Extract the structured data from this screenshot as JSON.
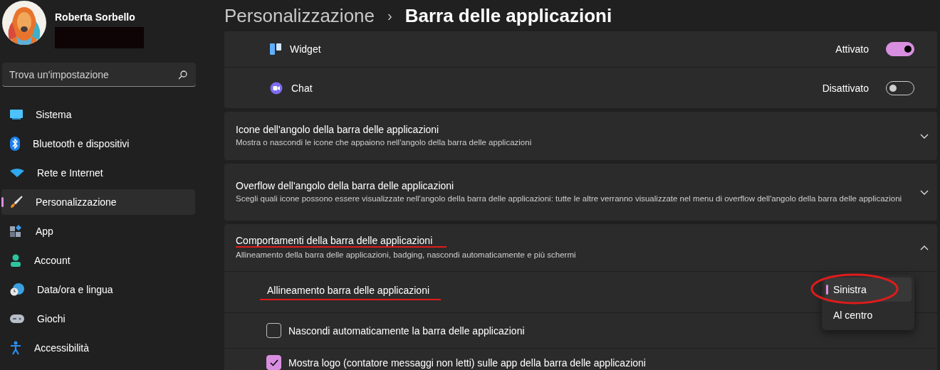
{
  "user": {
    "name": "Roberta Sorbello"
  },
  "search": {
    "placeholder": "Trova un'impostazione"
  },
  "sidebar": {
    "items": [
      {
        "label": "Sistema",
        "selected": false
      },
      {
        "label": "Bluetooth e dispositivi",
        "selected": false
      },
      {
        "label": "Rete e Internet",
        "selected": false
      },
      {
        "label": "Personalizzazione",
        "selected": true
      },
      {
        "label": "App",
        "selected": false
      },
      {
        "label": "Account",
        "selected": false
      },
      {
        "label": "Data/ora e lingua",
        "selected": false
      },
      {
        "label": "Giochi",
        "selected": false
      },
      {
        "label": "Accessibilità",
        "selected": false
      }
    ]
  },
  "breadcrumb": {
    "parent": "Personalizzazione",
    "separator": "›",
    "current": "Barra delle applicazioni"
  },
  "toggles": [
    {
      "label": "Widget",
      "state": "Attivato",
      "on": true
    },
    {
      "label": "Chat",
      "state": "Disattivato",
      "on": false
    }
  ],
  "sections": [
    {
      "title": "Icone dell'angolo della barra delle applicazioni",
      "description": "Mostra o nascondi le icone che appaiono nell'angolo della barra delle applicazioni",
      "expanded": false,
      "underlined": false
    },
    {
      "title": "Overflow dell'angolo della barra delle applicazioni",
      "description": "Scegli quali icone possono essere visualizzate nell'angolo della barra delle applicazioni: tutte le altre verranno visualizzate nel menu di overflow dell'angolo della barra delle applicazioni",
      "expanded": false,
      "underlined": false
    },
    {
      "title": "Comportamenti della barra delle applicazioni",
      "description": "Allineamento della barra delle applicazioni, badging, nascondi automaticamente e più schermi",
      "expanded": true,
      "underlined": true
    }
  ],
  "behaviors": [
    {
      "kind": "dropdown",
      "label": "Allineamento barra delle applicazioni",
      "underlined": true,
      "options": [
        {
          "label": "Sinistra",
          "selected": true,
          "circled": true
        },
        {
          "label": "Al centro",
          "selected": false,
          "circled": false
        }
      ]
    },
    {
      "kind": "checkbox",
      "label": "Nascondi automaticamente la barra delle applicazioni",
      "checked": false
    },
    {
      "kind": "checkbox",
      "label": "Mostra logo (contatore messaggi non letti) sulle app della barra delle applicazioni",
      "checked": true
    }
  ]
}
